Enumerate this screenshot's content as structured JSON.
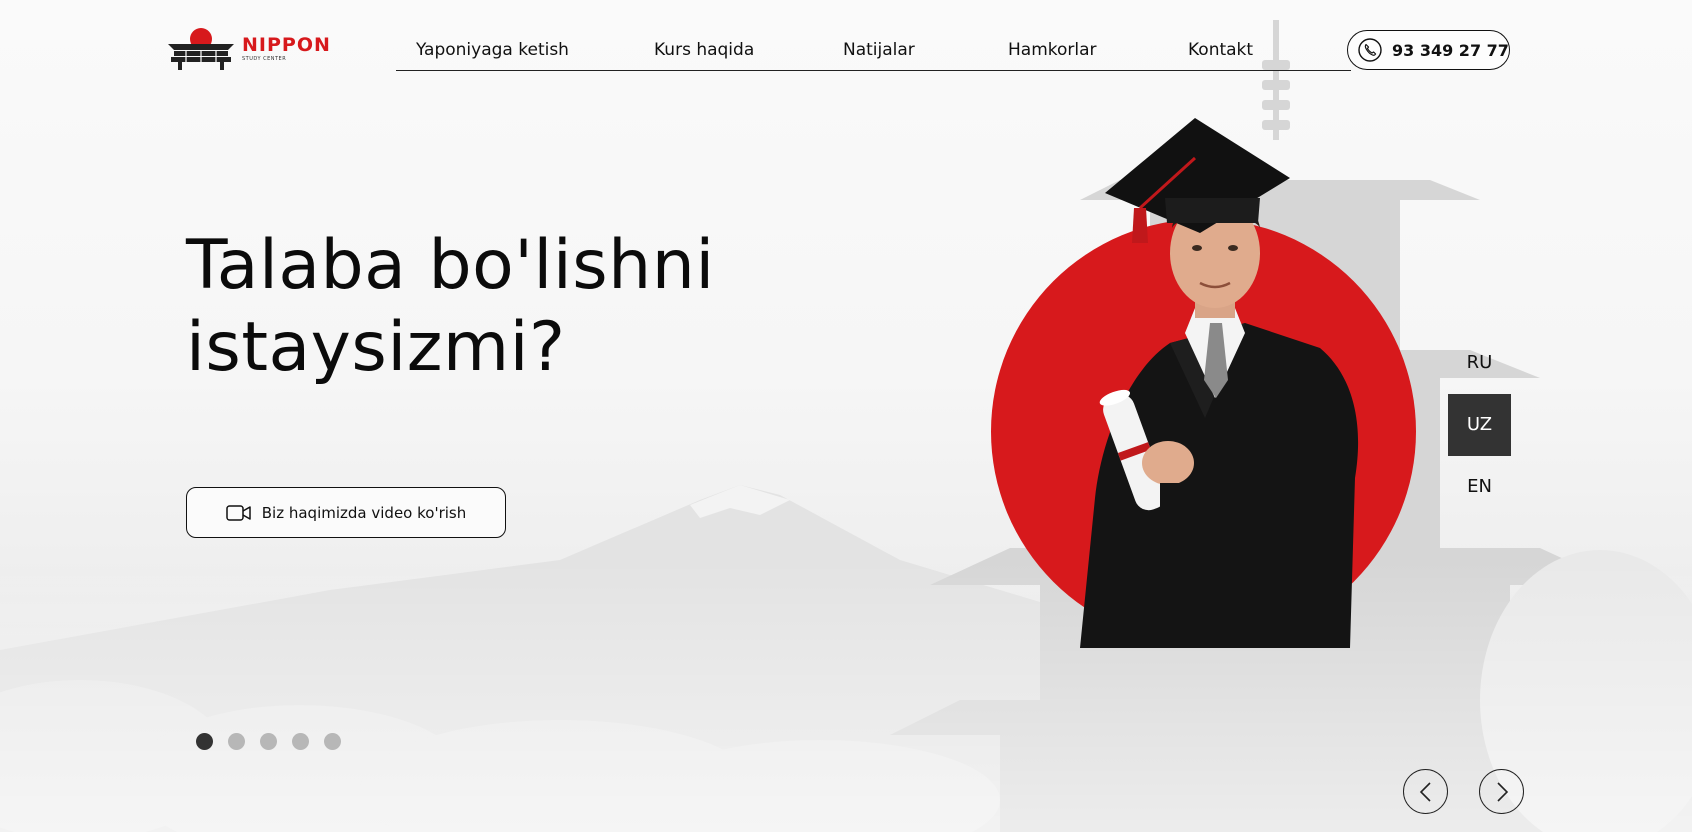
{
  "brand": {
    "name": "NIPPON",
    "tagline": "STUDY CENTER",
    "accent_color": "#d7191c"
  },
  "nav": {
    "items": [
      {
        "label": "Yaponiyaga ketish"
      },
      {
        "label": "Kurs haqida"
      },
      {
        "label": "Natijalar"
      },
      {
        "label": "Hamkorlar"
      },
      {
        "label": "Kontakt"
      }
    ],
    "phone": "93 349 27 77",
    "phone_icon": "phone-icon"
  },
  "hero": {
    "title_line1": "Talaba bo'lishni",
    "title_line2": "istaysizmi?",
    "video_button": "Biz haqimizda video ko'rish",
    "video_icon": "video-camera-icon"
  },
  "slider": {
    "total": 5,
    "active": 1
  },
  "languages": [
    {
      "code": "RU",
      "active": false
    },
    {
      "code": "UZ",
      "active": true
    },
    {
      "code": "EN",
      "active": false
    }
  ],
  "arrows": {
    "prev_icon": "chevron-left-icon",
    "next_icon": "chevron-right-icon"
  }
}
